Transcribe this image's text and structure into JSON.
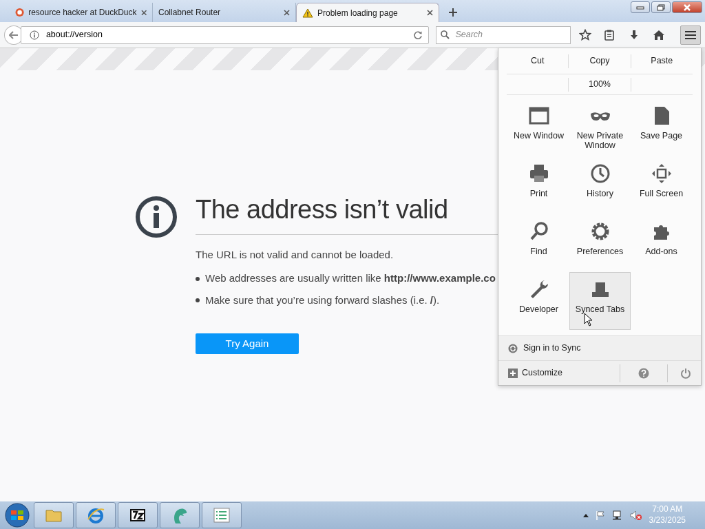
{
  "tabs": [
    {
      "title": "resource hacker at DuckDuck",
      "kind": "search",
      "selected": false
    },
    {
      "title": "Collabnet Router",
      "kind": "blank",
      "selected": false
    },
    {
      "title": "Problem loading page",
      "kind": "warning",
      "selected": true
    }
  ],
  "toolbar": {
    "url": "about://version",
    "search_placeholder": "Search"
  },
  "error_page": {
    "title": "The address isn’t valid",
    "message": "The URL is not valid and cannot be loaded.",
    "bullets": [
      "Web addresses are usually written like **http://www.example.co**",
      "Make sure that you’re using forward slashes (i.e. **/**)."
    ],
    "button": "Try Again"
  },
  "menu": {
    "edit": [
      "Cut",
      "Copy",
      "Paste"
    ],
    "zoom": "100%",
    "items": [
      {
        "label": "New Window",
        "kind": "window",
        "hovered": false
      },
      {
        "label": "New Private Window",
        "kind": "mask",
        "hovered": false
      },
      {
        "label": "Save Page",
        "kind": "page",
        "hovered": false
      },
      {
        "label": "Print",
        "kind": "print",
        "hovered": false
      },
      {
        "label": "History",
        "kind": "clock",
        "hovered": false
      },
      {
        "label": "Full Screen",
        "kind": "fullscreen",
        "hovered": false
      },
      {
        "label": "Find",
        "kind": "find",
        "hovered": false
      },
      {
        "label": "Preferences",
        "kind": "gear",
        "hovered": false
      },
      {
        "label": "Add-ons",
        "kind": "puzzle",
        "hovered": false
      },
      {
        "label": "Developer",
        "kind": "wrench",
        "hovered": false
      },
      {
        "label": "Synced Tabs",
        "kind": "synced",
        "hovered": true
      }
    ],
    "sign_in": "Sign in to Sync",
    "customize": "Customize"
  },
  "taskbar": {
    "time": "7:00 AM",
    "date": "3/23/2025"
  }
}
